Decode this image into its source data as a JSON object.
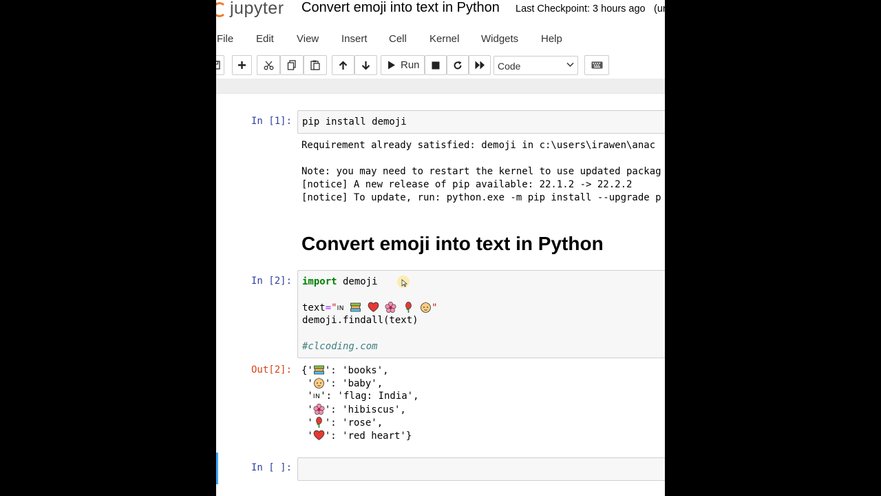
{
  "header": {
    "logo_text": "jupyter",
    "notebook_title": "Convert emoji into text in Python",
    "checkpoint": "Last Checkpoint: 3 hours ago",
    "trailing_status": "(ur"
  },
  "menu": {
    "items": [
      {
        "label": "File"
      },
      {
        "label": "Edit"
      },
      {
        "label": "View"
      },
      {
        "label": "Insert"
      },
      {
        "label": "Cell"
      },
      {
        "label": "Kernel"
      },
      {
        "label": "Widgets"
      },
      {
        "label": "Help"
      }
    ]
  },
  "toolbar": {
    "run_label": "Run",
    "cell_type": "Code",
    "icons": [
      "save-icon",
      "plus-icon",
      "scissors-icon",
      "copy-icon",
      "paste-icon",
      "arrow-up-icon",
      "arrow-down-icon",
      "play-icon",
      "stop-icon",
      "restart-icon",
      "fast-forward-icon",
      "chevron-down-icon",
      "keyboard-icon"
    ]
  },
  "cells": {
    "cell1": {
      "prompt": "In [1]:",
      "code": "pip install demoji",
      "output": [
        "Requirement already satisfied: demoji in c:\\users\\irawen\\anac",
        "",
        "Note: you may need to restart the kernel to use updated packag",
        "[notice] A new release of pip available: 22.1.2 -> 22.2.2",
        "[notice] To update, run: python.exe -m pip install --upgrade p"
      ]
    },
    "markdown": {
      "heading": "Convert emoji into text in Python"
    },
    "cell2": {
      "prompt": "In [2]:",
      "line1_kw": "import",
      "line1_rest": " demoji",
      "line2_var": "text",
      "line2_eq": "=",
      "line2_str_open": "\"",
      "line2_flag": "IN",
      "line2_str_close": "\"",
      "line3": "demoji.findall(text)",
      "line5_comment": "#clcoding.com",
      "out_prompt": "Out[2]:",
      "output": [
        {
          "pre": "{'",
          "post": "': 'books',"
        },
        {
          "pre": " '",
          "post": "': 'baby',"
        },
        {
          "pre": " '",
          "post": "': 'flag: India',",
          "flag": "IN"
        },
        {
          "pre": " '",
          "post": "': 'hibiscus',"
        },
        {
          "pre": " '",
          "post": "': 'rose',"
        },
        {
          "pre": " '",
          "post": "': 'red heart'}"
        }
      ]
    },
    "cell3": {
      "prompt": "In [ ]:"
    }
  },
  "colors": {
    "prompt_in": "#303f9f",
    "prompt_out": "#d84315",
    "keyword": "#008000",
    "string": "#ba2121",
    "comment": "#408080",
    "selected_cell": "#42a5f5"
  }
}
